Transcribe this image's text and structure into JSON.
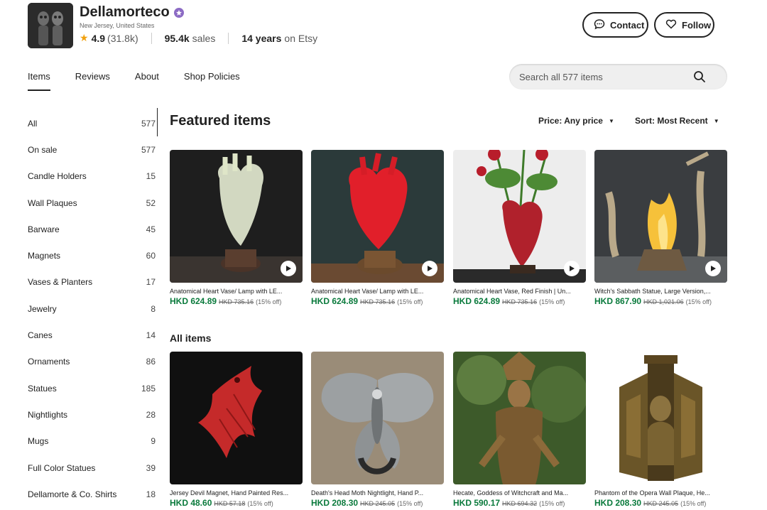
{
  "shop": {
    "name": "Dellamorteco",
    "location": "New Jersey, United States",
    "rating": "4.9",
    "rating_count": "(31.8k)",
    "sales_value": "95.4k",
    "sales_label": "sales",
    "years_value": "14 years",
    "years_label": "on Etsy"
  },
  "buttons": {
    "contact": "Contact",
    "follow": "Follow"
  },
  "tabs": [
    {
      "label": "Items",
      "active": true
    },
    {
      "label": "Reviews",
      "active": false
    },
    {
      "label": "About",
      "active": false
    },
    {
      "label": "Shop Policies",
      "active": false
    }
  ],
  "search": {
    "placeholder": "Search all 577 items"
  },
  "sidebar": [
    {
      "label": "All",
      "count": "577"
    },
    {
      "label": "On sale",
      "count": "577"
    },
    {
      "label": "Candle Holders",
      "count": "15"
    },
    {
      "label": "Wall Plaques",
      "count": "52"
    },
    {
      "label": "Barware",
      "count": "45"
    },
    {
      "label": "Magnets",
      "count": "60"
    },
    {
      "label": "Vases & Planters",
      "count": "17"
    },
    {
      "label": "Jewelry",
      "count": "8"
    },
    {
      "label": "Canes",
      "count": "14"
    },
    {
      "label": "Ornaments",
      "count": "86"
    },
    {
      "label": "Statues",
      "count": "185"
    },
    {
      "label": "Nightlights",
      "count": "28"
    },
    {
      "label": "Mugs",
      "count": "9"
    },
    {
      "label": "Full Color Statues",
      "count": "39"
    },
    {
      "label": "Dellamorte & Co. Shirts",
      "count": "18"
    }
  ],
  "featured": {
    "title": "Featured items",
    "price_filter": "Price: Any price",
    "sort": "Sort: Most Recent",
    "items": [
      {
        "title": "Anatomical Heart Vase/ Lamp with LE...",
        "price": "HKD 624.89",
        "orig": "HKD 735.16",
        "off": "(15% off)",
        "icon": "clear-heart-lamp",
        "video": true
      },
      {
        "title": "Anatomical Heart Vase/ Lamp with LE...",
        "price": "HKD 624.89",
        "orig": "HKD 735.16",
        "off": "(15% off)",
        "icon": "red-heart-lamp",
        "video": true
      },
      {
        "title": "Anatomical Heart Vase, Red Finish | Un...",
        "price": "HKD 624.89",
        "orig": "HKD 735.16",
        "off": "(15% off)",
        "icon": "heart-vase-roses",
        "video": true
      },
      {
        "title": "Witch's Sabbath Statue, Large Version,...",
        "price": "HKD 867.90",
        "orig": "HKD 1,021.06",
        "off": "(15% off)",
        "icon": "witch-statue",
        "video": true
      }
    ]
  },
  "all_items": {
    "title": "All items",
    "items": [
      {
        "title": "Jersey Devil Magnet, Hand Painted Res...",
        "price": "HKD 48.60",
        "orig": "HKD 57.18",
        "off": "(15% off)",
        "icon": "red-dragon-magnet"
      },
      {
        "title": "Death's Head Moth Nightlight, Hand P...",
        "price": "HKD 208.30",
        "orig": "HKD 245.05",
        "off": "(15% off)",
        "icon": "moth-nightlight"
      },
      {
        "title": "Hecate, Goddess of Witchcraft and Ma...",
        "price": "HKD 590.17",
        "orig": "HKD 694.32",
        "off": "(15% off)",
        "icon": "hecate-statue"
      },
      {
        "title": "Phantom of the Opera Wall Plaque, He...",
        "price": "HKD 208.30",
        "orig": "HKD 245.05",
        "off": "(15% off)",
        "icon": "phantom-plaque"
      }
    ]
  },
  "colors": {
    "price_green": "#0a7a3c",
    "star": "#f1a10f",
    "star_seller_badge": "#8c6bc4"
  }
}
